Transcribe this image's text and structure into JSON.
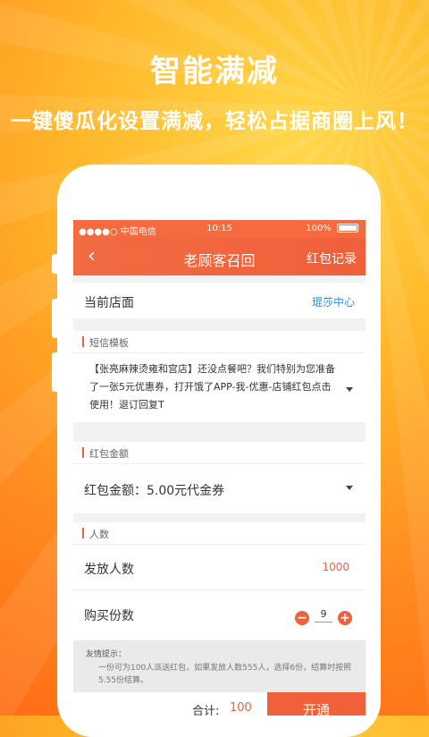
{
  "promo": {
    "headline": "智能满减",
    "subline": "一键傻瓜化设置满减，轻松占据商圈上风！"
  },
  "status_bar": {
    "carrier": "●●●●○ 中国电信",
    "time": "10:15",
    "battery": "100%"
  },
  "nav": {
    "back_icon": "‹",
    "title": "老顾客召回",
    "right_link": "红包记录"
  },
  "store": {
    "label": "当前店面",
    "value": "琨莎中心"
  },
  "sms": {
    "section_title": "短信模板",
    "text": "【张亮麻辣烫雍和宫店】还没点餐吧？我们特别为您准备了一张5元优惠券，打开饿了APP-我-优惠-店铺红包点击使用！退订回复T"
  },
  "amount": {
    "section_title": "红包金额",
    "label": "红包金额：",
    "value": "5.00元代金券"
  },
  "people": {
    "section_title": "人数",
    "send_label": "发放人数",
    "send_value": "1000",
    "buy_label": "购买份数",
    "buy_value": "9",
    "minus": "−",
    "plus": "+"
  },
  "tip": {
    "title": "友情提示：",
    "text": "一份可为100人派送红包，如果发放人数555人，选择6份，结算时按照5.55份结算。"
  },
  "footer": {
    "total_label": "合计:",
    "total_value": "100",
    "open_button": "开通"
  },
  "colors": {
    "accent": "#f0603a",
    "link": "#3a8ee6"
  }
}
